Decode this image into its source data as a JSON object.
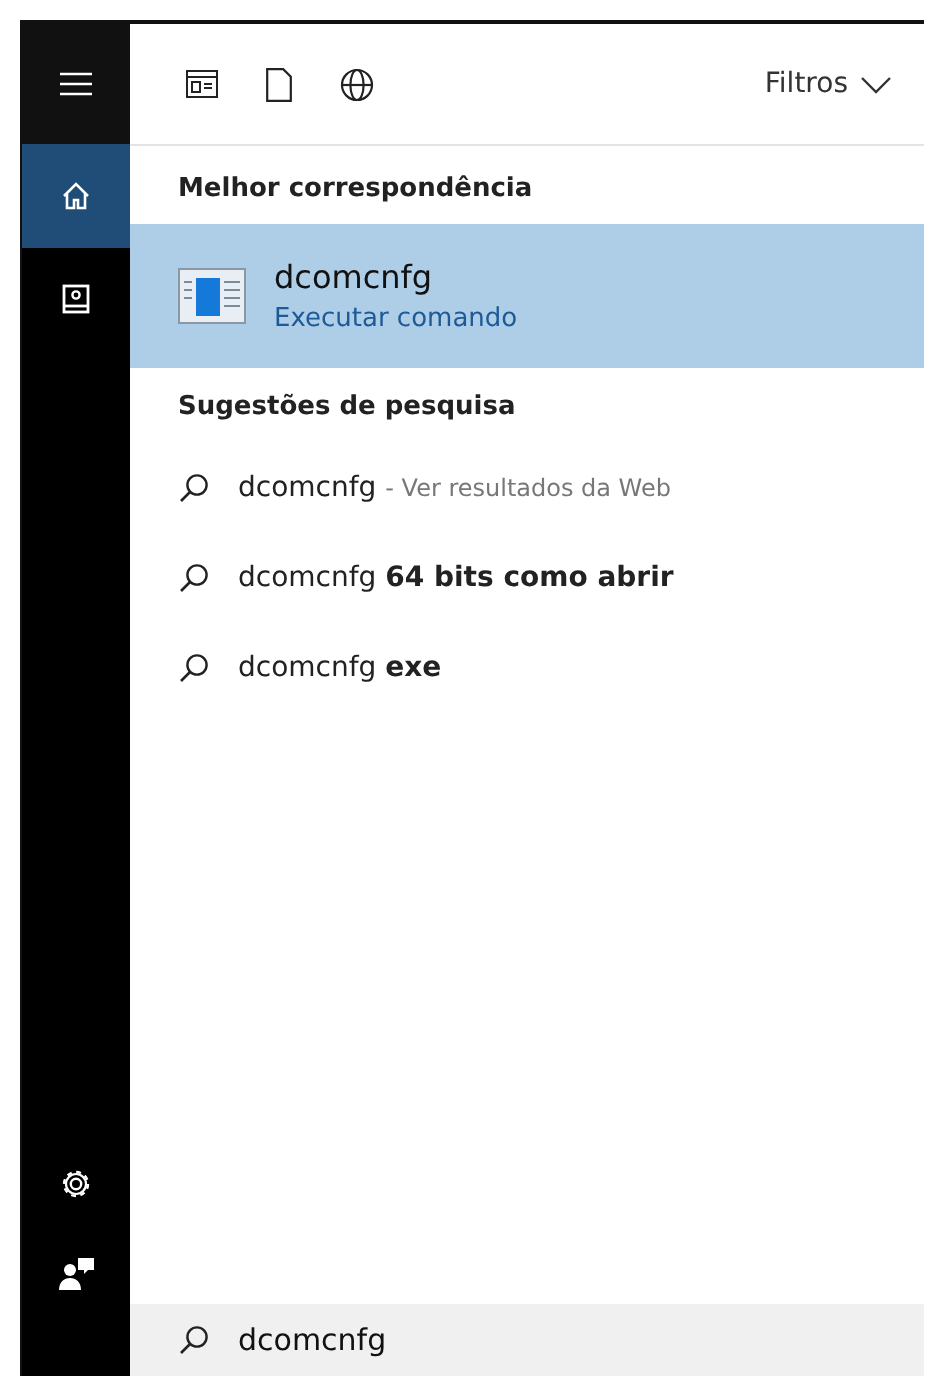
{
  "sidebar": {
    "top_items": [
      {
        "kind": "menu",
        "selected": false
      },
      {
        "kind": "home",
        "selected": true
      },
      {
        "kind": "notebook",
        "selected": false
      }
    ],
    "bottom_items": [
      {
        "kind": "settings",
        "selected": false
      },
      {
        "kind": "feedback",
        "selected": false
      }
    ]
  },
  "toolbar": {
    "filters_label": "Filtros"
  },
  "best_match": {
    "heading": "Melhor correspondência",
    "title": "dcomcnfg",
    "subtitle": "Executar comando",
    "selected": true
  },
  "suggestions": {
    "heading": "Sugestões de pesquisa",
    "items": [
      {
        "text": "dcomcnfg",
        "hint": "- Ver resultados da Web"
      },
      {
        "text": "dcomcnfg **64 bits como abrir**"
      },
      {
        "text": "dcomcnfg **exe**"
      }
    ]
  },
  "search": {
    "value": "dcomcnfg"
  }
}
